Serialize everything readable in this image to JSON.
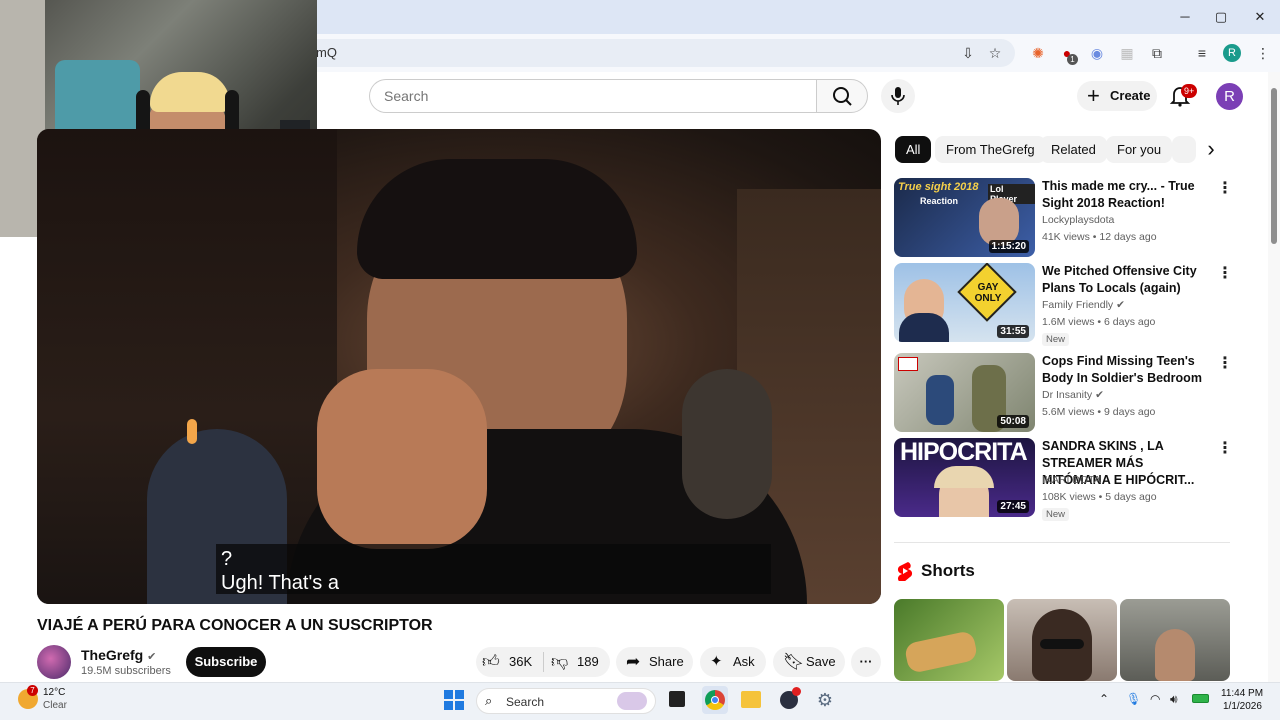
{
  "browser": {
    "url_fragment": "mQ",
    "window_controls": {
      "minimize": "─",
      "maximize": "▢",
      "close": "✕"
    },
    "profile_initial": "R",
    "extension_badge": "1"
  },
  "header": {
    "search_placeholder": "Search",
    "create_label": "Create",
    "notification_count": "9+",
    "avatar_initial": "R"
  },
  "video": {
    "caption_lines": [
      "?",
      "Ugh! That's a"
    ],
    "title": "VIAJÉ A PERÚ PARA CONOCER A UN SUSCRIPTOR",
    "channel": "TheGrefg",
    "subscribers": "19.5M subscribers",
    "subscribe_label": "Subscribe",
    "likes": "36K",
    "dislikes": "189",
    "share_label": "Share",
    "ask_label": "Ask",
    "save_label": "Save"
  },
  "chips": [
    "All",
    "From TheGrefg",
    "Related",
    "For you"
  ],
  "related": [
    {
      "title": "This made me cry... - True Sight 2018 Reaction!",
      "channel": "Lockyplaysdota",
      "verified": false,
      "meta": "41K views • 12 days ago",
      "duration": "1:15:20",
      "new": "",
      "thumb_text": "True sight 2018",
      "thumb_text2": "Lol Player",
      "thumb_text3": "Reaction",
      "thumb_color": "#1b2a4a"
    },
    {
      "title": "We Pitched Offensive City Plans To Locals (again)",
      "channel": "Family Friendly",
      "verified": true,
      "meta": "1.6M views • 6 days ago",
      "duration": "31:55",
      "new": "New",
      "thumb_text": "GAY",
      "thumb_text2": "ONLY",
      "thumb_text3": "",
      "thumb_color": "#8fb3d9"
    },
    {
      "title": "Cops Find Missing Teen's Body In Soldier's Bedroom",
      "channel": "Dr Insanity",
      "verified": true,
      "meta": "5.6M views • 9 days ago",
      "duration": "50:08",
      "new": "",
      "thumb_text": "",
      "thumb_text2": "",
      "thumb_text3": "",
      "thumb_color": "#9aa08a"
    },
    {
      "title": "SANDRA SKINS , LA STREAMER MÁS MITÓMANA E HIPÓCRIT...",
      "channel": "IKARI DOTA",
      "verified": false,
      "meta": "108K views • 5 days ago",
      "duration": "27:45",
      "new": "New",
      "thumb_text": "HIPOCRITA",
      "thumb_text2": "",
      "thumb_text3": "",
      "thumb_color": "#2a1f4a"
    }
  ],
  "shorts_label": "Shorts",
  "taskbar": {
    "weather_temp": "12°C",
    "weather_desc": "Clear",
    "weather_badge": "7",
    "search_label": "Search",
    "time": "11:44 PM",
    "date": "1/1/2026"
  },
  "colors": {
    "accent_red": "#cc0000",
    "avatar_purple": "#7b3fb5",
    "text": "#0f0f0f",
    "meta": "#606060"
  }
}
